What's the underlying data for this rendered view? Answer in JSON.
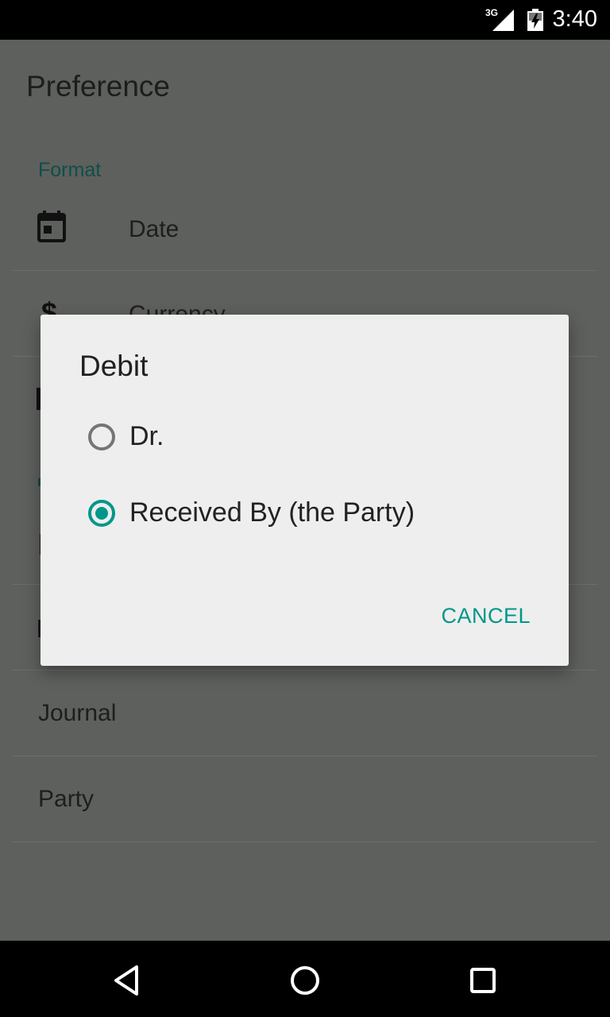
{
  "status_bar": {
    "time": "3:40",
    "network": "3G",
    "icons": [
      "signal-icon",
      "battery-charging-icon"
    ]
  },
  "page": {
    "title": "Preference",
    "sections": [
      {
        "header": "Format",
        "items": [
          {
            "label": "Date",
            "icon": "calendar-icon"
          },
          {
            "label": "Currency",
            "icon": "dollar-icon"
          }
        ]
      }
    ],
    "items_below": [
      {
        "label": "Journal"
      },
      {
        "label": "Party"
      }
    ]
  },
  "dialog": {
    "title": "Debit",
    "options": [
      {
        "label": "Dr.",
        "selected": false
      },
      {
        "label": "Received By (the Party)",
        "selected": true
      }
    ],
    "cancel_label": "CANCEL"
  },
  "nav_bar": {
    "buttons": [
      "back-icon",
      "home-icon",
      "recents-icon"
    ]
  },
  "colors": {
    "accent": "#00978a",
    "section_header": "#0d4f4b",
    "scrim_background": "#5e605d",
    "dialog_background": "#eeeeee"
  }
}
